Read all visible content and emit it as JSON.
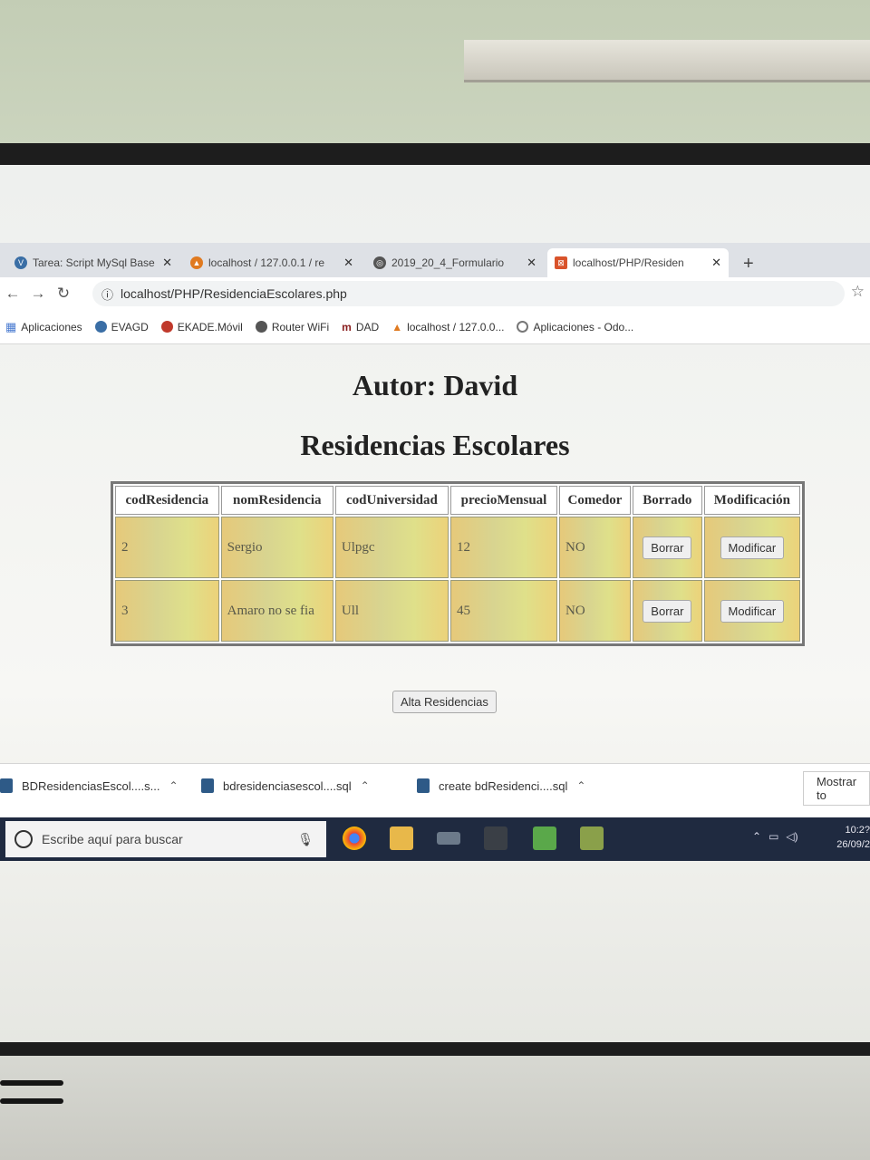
{
  "browser": {
    "tabs": [
      {
        "title": "Tarea: Script MySql Base",
        "icon": "moodle-icon",
        "color": "#3a6ea5"
      },
      {
        "title": "localhost / 127.0.0.1 / re",
        "icon": "phpmyadmin-icon",
        "color": "#e07a20"
      },
      {
        "title": "2019_20_4_Formulario",
        "icon": "globe-icon",
        "color": "#555555"
      },
      {
        "title": "localhost/PHP/Residen",
        "icon": "xampp-icon",
        "color": "#d9532b"
      }
    ],
    "new_tab": "+",
    "url": "localhost/PHP/ResidenciaEscolares.php",
    "bookmarks": [
      {
        "label": "Aplicaciones",
        "color": "#4a7bd0"
      },
      {
        "label": "EVAGD",
        "color": "#3a6ea5"
      },
      {
        "label": "EKADE.Móvil",
        "color": "#c0392b"
      },
      {
        "label": "Router WiFi",
        "color": "#555555"
      },
      {
        "label": "DAD",
        "color": "#8a1f1f"
      },
      {
        "label": "localhost / 127.0.0...",
        "color": "#e07a20"
      },
      {
        "label": "Aplicaciones - Odo...",
        "color": "#777777"
      }
    ]
  },
  "page": {
    "author_heading": "Autor: David",
    "title": "Residencias Escolares",
    "table": {
      "headers": [
        "codResidencia",
        "nomResidencia",
        "codUniversidad",
        "precioMensual",
        "Comedor",
        "Borrado",
        "Modificación"
      ],
      "rows": [
        {
          "codResidencia": "2",
          "nomResidencia": "Sergio",
          "codUniversidad": "Ulpgc",
          "precioMensual": "12",
          "comedor": "NO",
          "delete_label": "Borrar",
          "edit_label": "Modificar"
        },
        {
          "codResidencia": "3",
          "nomResidencia": "Amaro no se fia",
          "codUniversidad": "Ull",
          "precioMensual": "45",
          "comedor": "NO",
          "delete_label": "Borrar",
          "edit_label": "Modificar"
        }
      ]
    },
    "add_button": "Alta Residencias"
  },
  "downloads": [
    {
      "name": "BDResidenciasEscol....s..."
    },
    {
      "name": "bdresidenciasescol....sql"
    },
    {
      "name": "create bdResidenci....sql"
    }
  ],
  "show_all": "Mostrar to",
  "taskbar": {
    "search_placeholder": "Escribe aquí para buscar",
    "time": "10:2?",
    "date": "26/09/2"
  }
}
